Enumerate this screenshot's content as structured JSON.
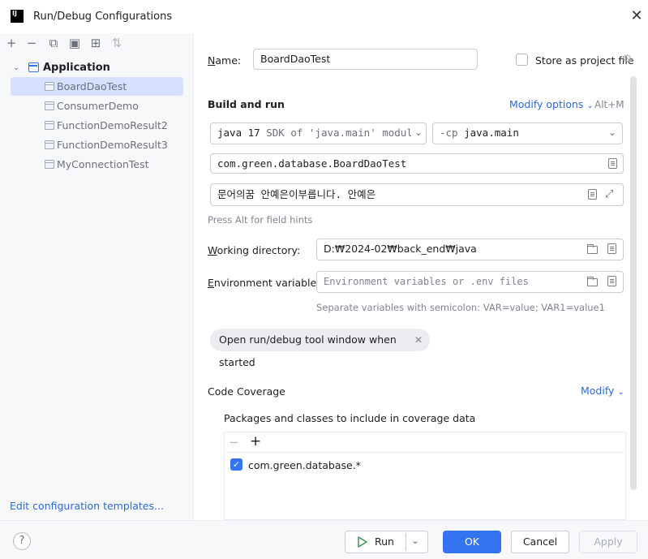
{
  "window": {
    "title": "Run/Debug Configurations",
    "logo_text": "IJ"
  },
  "sidebar": {
    "group_label": "Application",
    "items": [
      {
        "label": "BoardDaoTest",
        "selected": true
      },
      {
        "label": "ConsumerDemo",
        "selected": false
      },
      {
        "label": "FunctionDemoResult2",
        "selected": false
      },
      {
        "label": "FunctionDemoResult3",
        "selected": false
      },
      {
        "label": "MyConnectionTest",
        "selected": false
      }
    ],
    "edit_templates_link": "Edit configuration templates..."
  },
  "config": {
    "name_label": "Name:",
    "name_value": "BoardDaoTest",
    "store_label": "Store as project file",
    "build_run_title": "Build and run",
    "modify_options_label": "Modify options",
    "modify_options_shortcut": "Alt+M",
    "jdk_value_bold": "java 17",
    "jdk_value_rest": "SDK of 'java.main' module",
    "cp_prefix": "-cp",
    "cp_value": "java.main",
    "main_class": "com.green.database.BoardDaoTest",
    "program_args": "문어의꿈 안예은이부릅니다. 안예은",
    "field_hint": "Press Alt for field hints",
    "working_dir_label": "Working directory:",
    "working_dir_value": "D:₩2024-02₩back_end₩java",
    "env_label": "Environment variables:",
    "env_placeholder": "Environment variables or .env files",
    "env_hint": "Separate variables with semicolon: VAR=value; VAR1=value1",
    "chip_label": "Open run/debug tool window when started",
    "coverage_title": "Code Coverage",
    "coverage_modify": "Modify",
    "coverage_packages_label": "Packages and classes to include in coverage data",
    "coverage_items": [
      {
        "label": "com.green.database.*",
        "checked": true
      }
    ]
  },
  "buttons": {
    "help": "?",
    "run": "Run",
    "ok": "OK",
    "cancel": "Cancel",
    "apply": "Apply"
  },
  "colors": {
    "accent": "#3574f0",
    "link": "#2e6ad0",
    "selection": "#d5e1ff"
  }
}
